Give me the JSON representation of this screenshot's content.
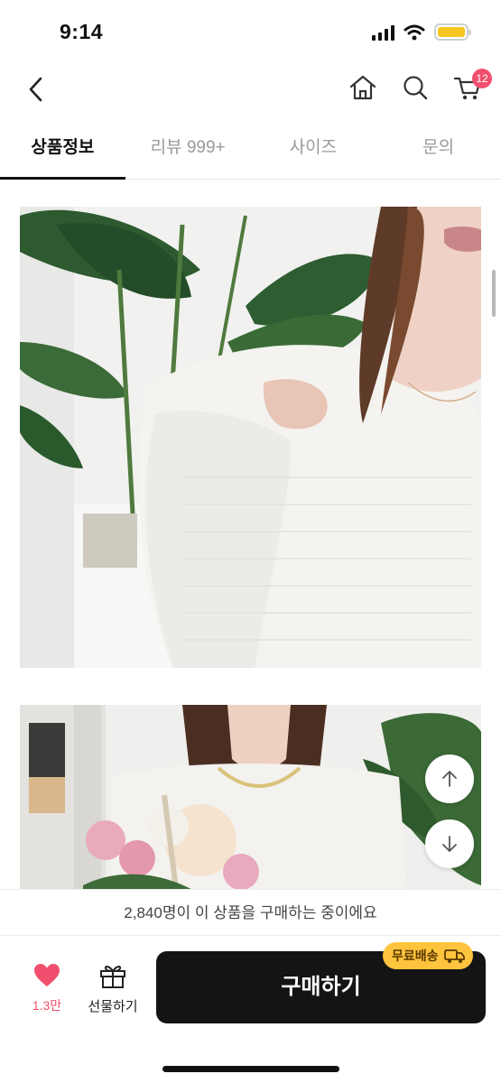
{
  "status": {
    "time": "9:14"
  },
  "nav": {
    "cart_count": "12"
  },
  "tabs": [
    {
      "label": "상품정보",
      "active": true
    },
    {
      "label": "리뷰 999+",
      "active": false
    },
    {
      "label": "사이즈",
      "active": false
    },
    {
      "label": "문의",
      "active": false
    }
  ],
  "buyers_strip": {
    "text": "2,840명이 이 상품을 구매하는 중이에요"
  },
  "bottom_bar": {
    "like_count": "1.3만",
    "gift_label": "선물하기",
    "buy_label": "구매하기",
    "shipping_badge": "무료배송"
  },
  "colors": {
    "accent": "#f0506e",
    "badge": "#ffc43d",
    "buy_button": "#141414"
  },
  "icons": [
    "back-chevron-icon",
    "home-icon",
    "search-icon",
    "cart-icon",
    "scroll-up-icon",
    "scroll-down-icon",
    "heart-icon",
    "gift-icon",
    "truck-icon"
  ]
}
